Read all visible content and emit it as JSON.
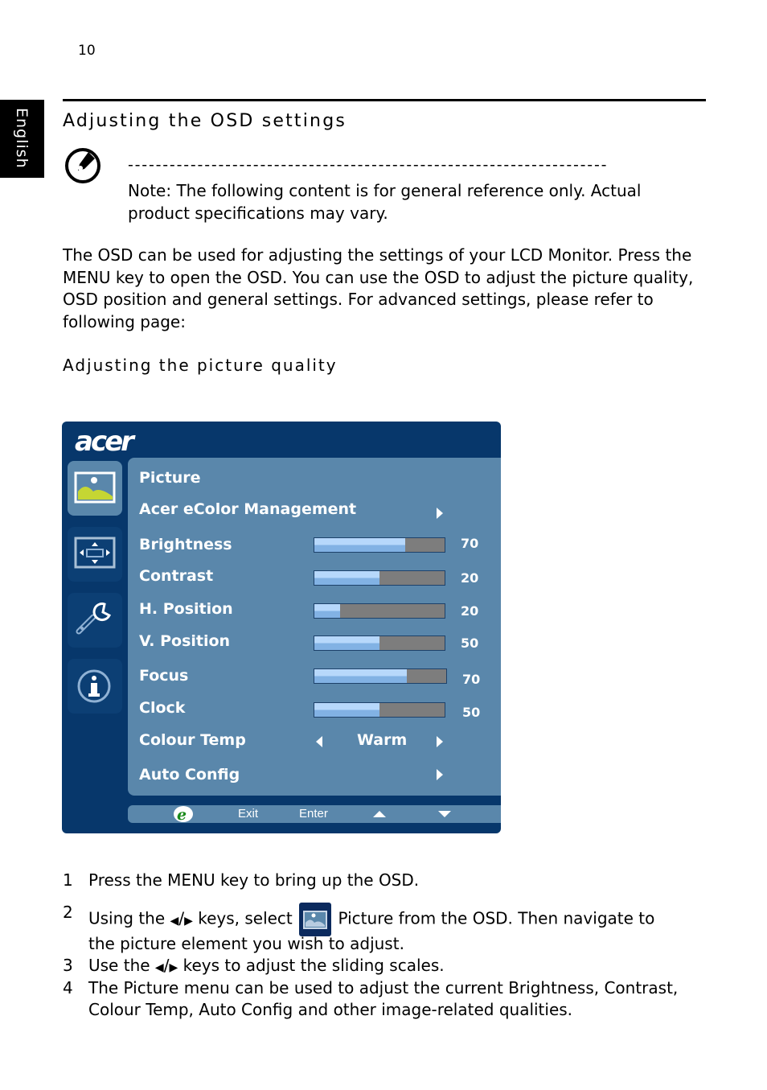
{
  "page": {
    "page_number": "10",
    "language_tab": "English",
    "section_title": "Adjusting the OSD settings",
    "note_icon": "note-icon",
    "note_dashes": "---------------------------------------------------------------------",
    "note_text": "Note: The following content is for general reference only. Actual product specifications may vary.",
    "intro_paragraph": "The OSD can be used for adjusting the settings of your LCD Monitor. Press the MENU key to open the OSD. You can use the OSD to adjust the picture quality, OSD position and general settings. For advanced settings, please refer to following page:",
    "subsection_title": "Adjusting the picture quality"
  },
  "osd": {
    "brand": "acer",
    "sidebar": [
      {
        "icon": "picture-icon",
        "active": true
      },
      {
        "icon": "osd-position-icon",
        "active": false
      },
      {
        "icon": "settings-wrench-icon",
        "active": false
      },
      {
        "icon": "info-icon",
        "active": false
      }
    ],
    "menu_title": "Picture",
    "ecolor_label": "Acer eColor Management",
    "sliders": [
      {
        "label": "Brightness",
        "value": "70",
        "level": 70
      },
      {
        "label": "Contrast",
        "value": "50",
        "level": 50
      },
      {
        "label": "H. Position",
        "value": "20",
        "level": 20
      },
      {
        "label": "V. Position",
        "value": "50",
        "level": 50
      },
      {
        "label": "Focus",
        "value": "70",
        "level": 70
      },
      {
        "label": "Clock",
        "value": "50",
        "level": 50
      }
    ],
    "colour_temp": {
      "label": "Colour Temp",
      "value": "Warm"
    },
    "auto_config": {
      "label": "Auto Config"
    },
    "footer": {
      "e_key": "e",
      "exit": "Exit",
      "enter": "Enter",
      "up": "up-arrow-icon",
      "down": "down-arrow-icon"
    },
    "colors": {
      "frame": "#07376b",
      "panel": "#5a87ab",
      "bar_fill": "#82b2e4",
      "bar_empty": "#7d7d7d",
      "icon_accent": "#c5d633"
    }
  },
  "steps": [
    {
      "num": "1",
      "text": "Press the MENU key to bring up the OSD."
    },
    {
      "num": "2",
      "text_before": "Using the",
      "sep": "/",
      "text_mid": "keys, select",
      "text_after": "Picture from the OSD. Then navigate to",
      "text_line2": "the picture element you wish to adjust."
    },
    {
      "num": "3",
      "text_before": "Use the",
      "sep": "/",
      "text_after": "keys to adjust the sliding scales."
    },
    {
      "num": "4",
      "text": "The Picture menu can be used to adjust the current Brightness, Contrast,",
      "text_line2": "Colour Temp, Auto Config and other image-related qualities."
    }
  ]
}
